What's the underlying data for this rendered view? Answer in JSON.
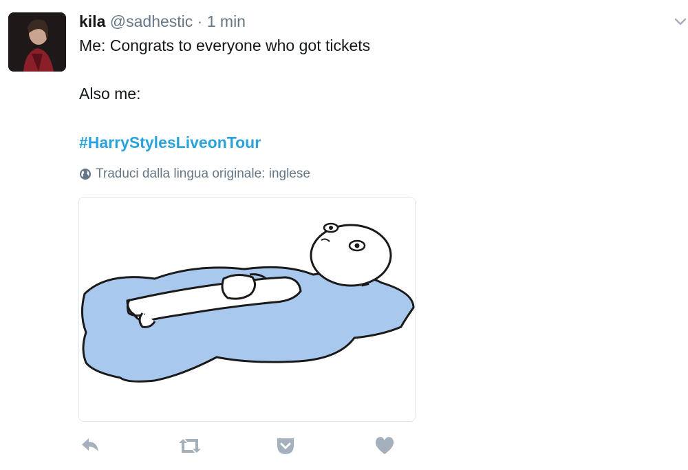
{
  "tweet": {
    "author_name": "kila",
    "handle": "@sadhestic",
    "separator": "·",
    "time": "1 min",
    "lines": [
      "Me: Congrats to everyone who got tickets",
      "Also me:"
    ],
    "hashtag": "#HarryStylesLiveonTour",
    "translate_label": "Traduci dalla lingua originale: inglese"
  },
  "icons": {
    "menu": "chevron-down-icon",
    "translate": "globe-icon",
    "reply": "reply-icon",
    "retweet": "retweet-icon",
    "save": "pocket-icon",
    "like": "heart-icon"
  },
  "colors": {
    "hashtag": "#2aa3dd",
    "meta": "#657786",
    "action_icon": "#a4b1bd",
    "puddle": "#a9c8ee"
  }
}
